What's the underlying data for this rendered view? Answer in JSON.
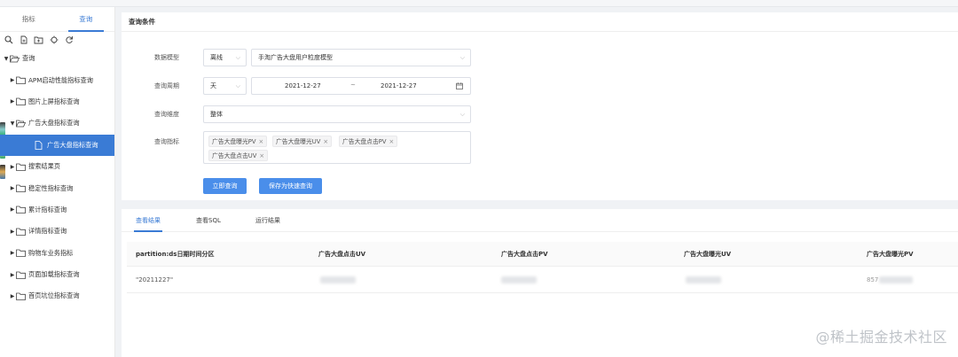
{
  "sidebar": {
    "tabs": [
      "指标",
      "查询"
    ],
    "toolbar_icons": [
      "search-icon",
      "new-file-icon",
      "new-folder-icon",
      "locate-icon",
      "refresh-icon"
    ],
    "tree": [
      {
        "label": "查询",
        "level": 0,
        "expanded": true,
        "type": "folder-open"
      },
      {
        "label": "APM启动性能指标查询",
        "level": 1,
        "type": "folder"
      },
      {
        "label": "图片上屏指标查询",
        "level": 1,
        "type": "folder"
      },
      {
        "label": "广告大盘指标查询",
        "level": 1,
        "expanded": true,
        "type": "folder-open"
      },
      {
        "label": "广告大盘指标查询",
        "level": 2,
        "type": "file",
        "selected": true
      },
      {
        "label": "搜索结果页",
        "level": 1,
        "type": "folder"
      },
      {
        "label": "稳定性指标查询",
        "level": 1,
        "type": "folder"
      },
      {
        "label": "累计指标查询",
        "level": 1,
        "type": "folder"
      },
      {
        "label": "详情指标查询",
        "level": 1,
        "type": "folder"
      },
      {
        "label": "购物车业务指标",
        "level": 1,
        "type": "folder"
      },
      {
        "label": "页面加载指标查询",
        "level": 1,
        "type": "folder"
      },
      {
        "label": "首页坑位指标查询",
        "level": 1,
        "type": "folder"
      }
    ]
  },
  "query": {
    "title": "查询条件",
    "model_label": "数据模型",
    "model_mode": "离线",
    "model_value": "手淘广告大盘用户粒度模型",
    "period_label": "查询周期",
    "period_unit": "天",
    "date_start": "2021-12-27",
    "date_sep": "~",
    "date_end": "2021-12-27",
    "dimension_label": "查询维度",
    "dimension_value": "整体",
    "metrics_label": "查询指标",
    "metrics": [
      "广告大盘曝光PV",
      "广告大盘曝光UV",
      "广告大盘点击PV",
      "广告大盘点击UV"
    ],
    "query_button": "立即查询",
    "save_button": "保存为快速查询"
  },
  "results": {
    "tabs": [
      "查看结果",
      "查看SQL",
      "运行结果"
    ],
    "columns": [
      "partition:ds日期时间分区",
      "广告大盘点击UV",
      "广告大盘点击PV",
      "广告大盘曝光UV",
      "广告大盘曝光PV"
    ],
    "row": {
      "partition": "\"20211227\"",
      "last_partial": "857"
    }
  },
  "watermark": "@稀土掘金技术社区",
  "colors": {
    "primary": "#3a7bd5",
    "button": "#4a8eea"
  }
}
